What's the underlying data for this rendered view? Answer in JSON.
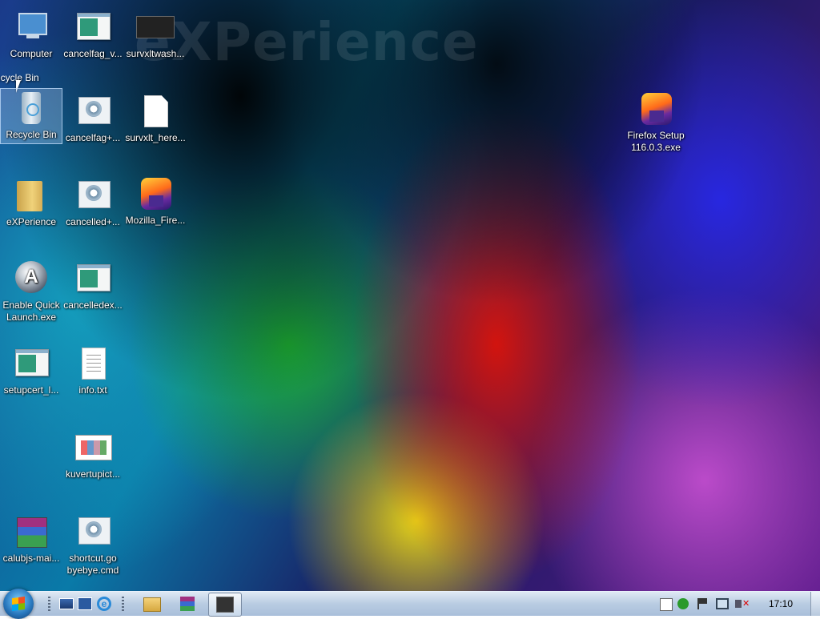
{
  "desktop": {
    "watermark": "eXPerience",
    "ghost_label": "ecycle Bin",
    "icons": [
      {
        "label": "Computer"
      },
      {
        "label": "cancelfag_v..."
      },
      {
        "label": "survxltwash..."
      },
      {
        "label": "Recycle Bin"
      },
      {
        "label": "cancelfag+..."
      },
      {
        "label": "survxlt_here..."
      },
      {
        "label": "Firefox Setup\n116.0.3.exe"
      },
      {
        "label": "eXPerience"
      },
      {
        "label": "cancelled+..."
      },
      {
        "label": "Mozilla_Fire..."
      },
      {
        "label": "Enable Quick\nLaunch.exe"
      },
      {
        "label": "cancelledex..."
      },
      {
        "label": "setupcert_l..."
      },
      {
        "label": "info.txt"
      },
      {
        "label": "kuvertupict..."
      },
      {
        "label": "calubjs-mai..."
      },
      {
        "label": "shortcut.go\nbyebye.cmd"
      }
    ]
  },
  "taskbar": {
    "clock": "17:10",
    "ie_glyph": "e"
  }
}
